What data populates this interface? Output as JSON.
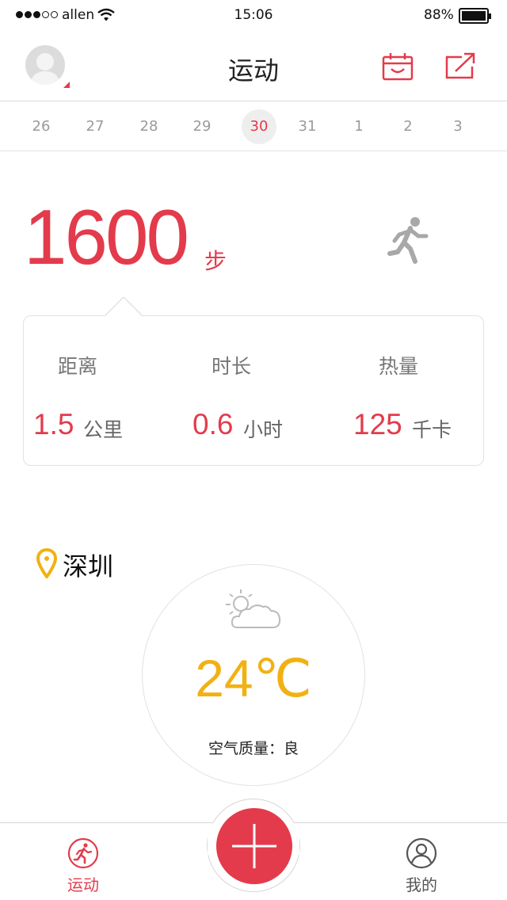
{
  "status_bar": {
    "carrier": "allen",
    "time": "15:06",
    "battery_percent": "88%"
  },
  "nav": {
    "title": "运动"
  },
  "date_strip": {
    "dates": [
      "26",
      "27",
      "28",
      "29",
      "30",
      "31",
      "1",
      "2",
      "3"
    ],
    "selected": "30"
  },
  "steps": {
    "count": "1600",
    "unit": "步"
  },
  "stats": {
    "distance": {
      "label": "距离",
      "value": "1.5",
      "unit": "公里"
    },
    "duration": {
      "label": "时长",
      "value": "0.6",
      "unit": "小时"
    },
    "calories": {
      "label": "热量",
      "value": "125",
      "unit": "千卡"
    }
  },
  "weather": {
    "city": "深圳",
    "temperature": "24℃",
    "air_quality": "空气质量：良",
    "condition_icon": "partly-cloudy-icon"
  },
  "tab_bar": {
    "tabs": [
      {
        "label": "运动",
        "icon": "runner-tab-icon"
      },
      {
        "label": "我的",
        "icon": "user-icon"
      }
    ],
    "center_button_icon": "plus-icon"
  },
  "colors": {
    "accent": "#e33b4c",
    "temperature": "#f2b112",
    "pin": "#f2b112"
  }
}
